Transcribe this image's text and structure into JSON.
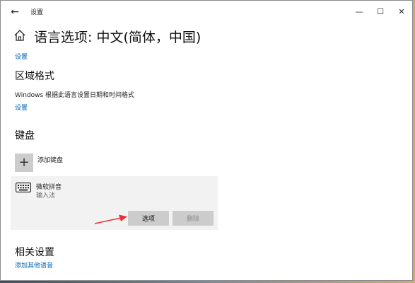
{
  "window": {
    "title": "设置",
    "back_glyph": "←",
    "controls": {
      "minimize": "—",
      "maximize": "☐",
      "close": "✕"
    }
  },
  "page": {
    "title": "语言选项: 中文(简体，中国)"
  },
  "top_link": "设置",
  "region": {
    "heading": "区域格式",
    "description": "Windows 根据此语言设置日期和时间格式",
    "link": "设置"
  },
  "keyboard": {
    "heading": "键盘",
    "add_label": "添加键盘",
    "add_glyph": "+",
    "item": {
      "name": "微软拼音",
      "type": "输入法"
    },
    "options_label": "选项",
    "delete_label": "删除"
  },
  "related": {
    "heading": "相关设置",
    "link": "添加其他语音"
  },
  "colors": {
    "link": "#0063b1",
    "accent_arrow": "#e8333a",
    "card_bg": "#f2f2f2",
    "button_bg": "#cccccc"
  },
  "icons": [
    "back-arrow-icon",
    "home-icon",
    "plus-icon",
    "keyboard-icon",
    "red-arrow-icon"
  ]
}
